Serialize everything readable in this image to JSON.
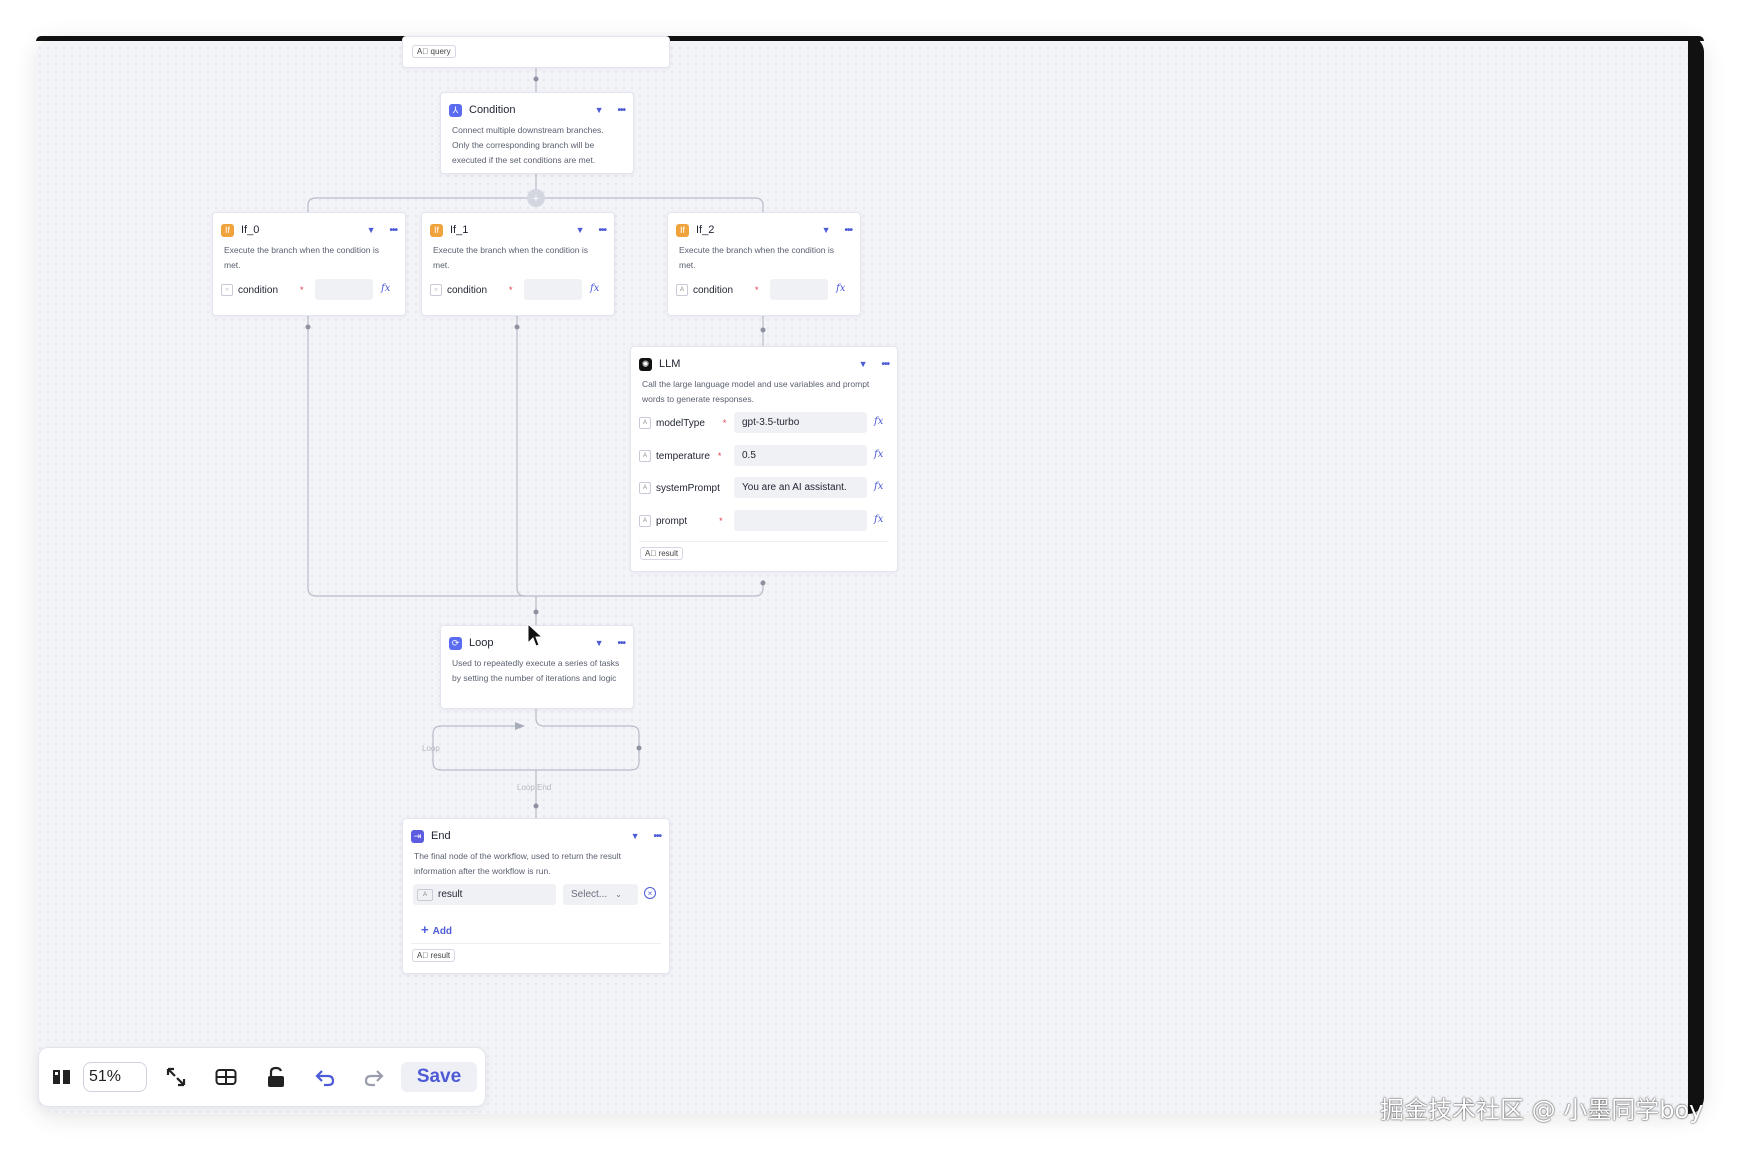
{
  "canvas": {
    "top_node_tag": "A⃞ query"
  },
  "condition_node": {
    "title": "Condition",
    "description": "Connect multiple downstream branches. Only the corresponding branch will be executed if the set conditions are met."
  },
  "if_nodes": [
    {
      "title": "If_0",
      "description": "Execute the branch when the condition is met.",
      "param_label": "condition"
    },
    {
      "title": "If_1",
      "description": "Execute the branch when the condition is met.",
      "param_label": "condition"
    },
    {
      "title": "If_2",
      "description": "Execute the branch when the condition is met.",
      "param_label": "condition"
    }
  ],
  "llm_node": {
    "title": "LLM",
    "description": "Call the large language model and use variables and prompt words to generate responses.",
    "params": [
      {
        "label": "modelType",
        "value": "gpt-3.5-turbo",
        "required": "*"
      },
      {
        "label": "temperature",
        "value": "0.5",
        "required": "*"
      },
      {
        "label": "systemPrompt",
        "value": "You are an AI assistant.",
        "required": ""
      },
      {
        "label": "prompt",
        "value": "",
        "required": "*"
      }
    ],
    "output_tag": "A⃞ result"
  },
  "loop_node": {
    "title": "Loop",
    "description": "Used to repeatedly execute a series of tasks by setting the number of iterations and logic",
    "loop_label": "Loop",
    "loop_end_label": "Loop End"
  },
  "end_node": {
    "title": "End",
    "description": "The final node of the workflow, used to return the result information after the workflow is run.",
    "output_name": "result",
    "select_placeholder": "Select...",
    "add_label": "Add",
    "output_tag": "A⃞ result"
  },
  "toolbar": {
    "zoom": "51%",
    "save_label": "Save",
    "icons": [
      "minimap-icon",
      "fit-view-icon",
      "layout-icon",
      "lock-icon",
      "undo-icon",
      "redo-icon"
    ]
  },
  "watermark": "掘金技术社区 @ 小墨同学boy",
  "colors": {
    "accent": "#4d5bd6",
    "if_icon": "#f0a33a",
    "condition_icon": "#5b6cf0",
    "loop_icon": "#5b6cf0",
    "end_icon": "#5b5ce0",
    "llm_icon": "#111111"
  }
}
